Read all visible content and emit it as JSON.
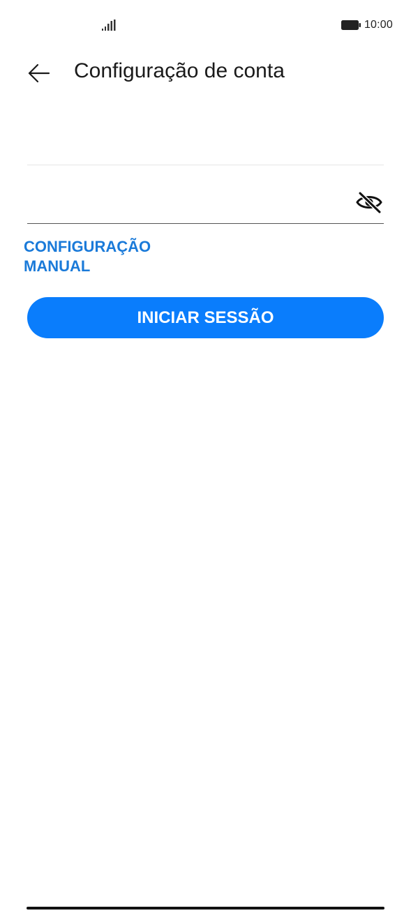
{
  "status_bar": {
    "time": "10:00",
    "signal_icon": "signal-bars-icon",
    "battery_icon": "battery-icon"
  },
  "header": {
    "title": "Configuração de conta",
    "back_icon": "arrow-left-icon"
  },
  "form": {
    "field_1": {
      "value": "",
      "placeholder": ""
    },
    "field_2": {
      "value": "",
      "placeholder": "",
      "visibility_icon": "eye-slash-icon"
    }
  },
  "manual_setup_link": "CONFIGURAÇÃO\nMANUAL",
  "login_button": "INICIAR SESSÃO",
  "colors": {
    "primary": "#0A7DFC",
    "link": "#1A7AD9",
    "text": "#1A1A1A"
  }
}
